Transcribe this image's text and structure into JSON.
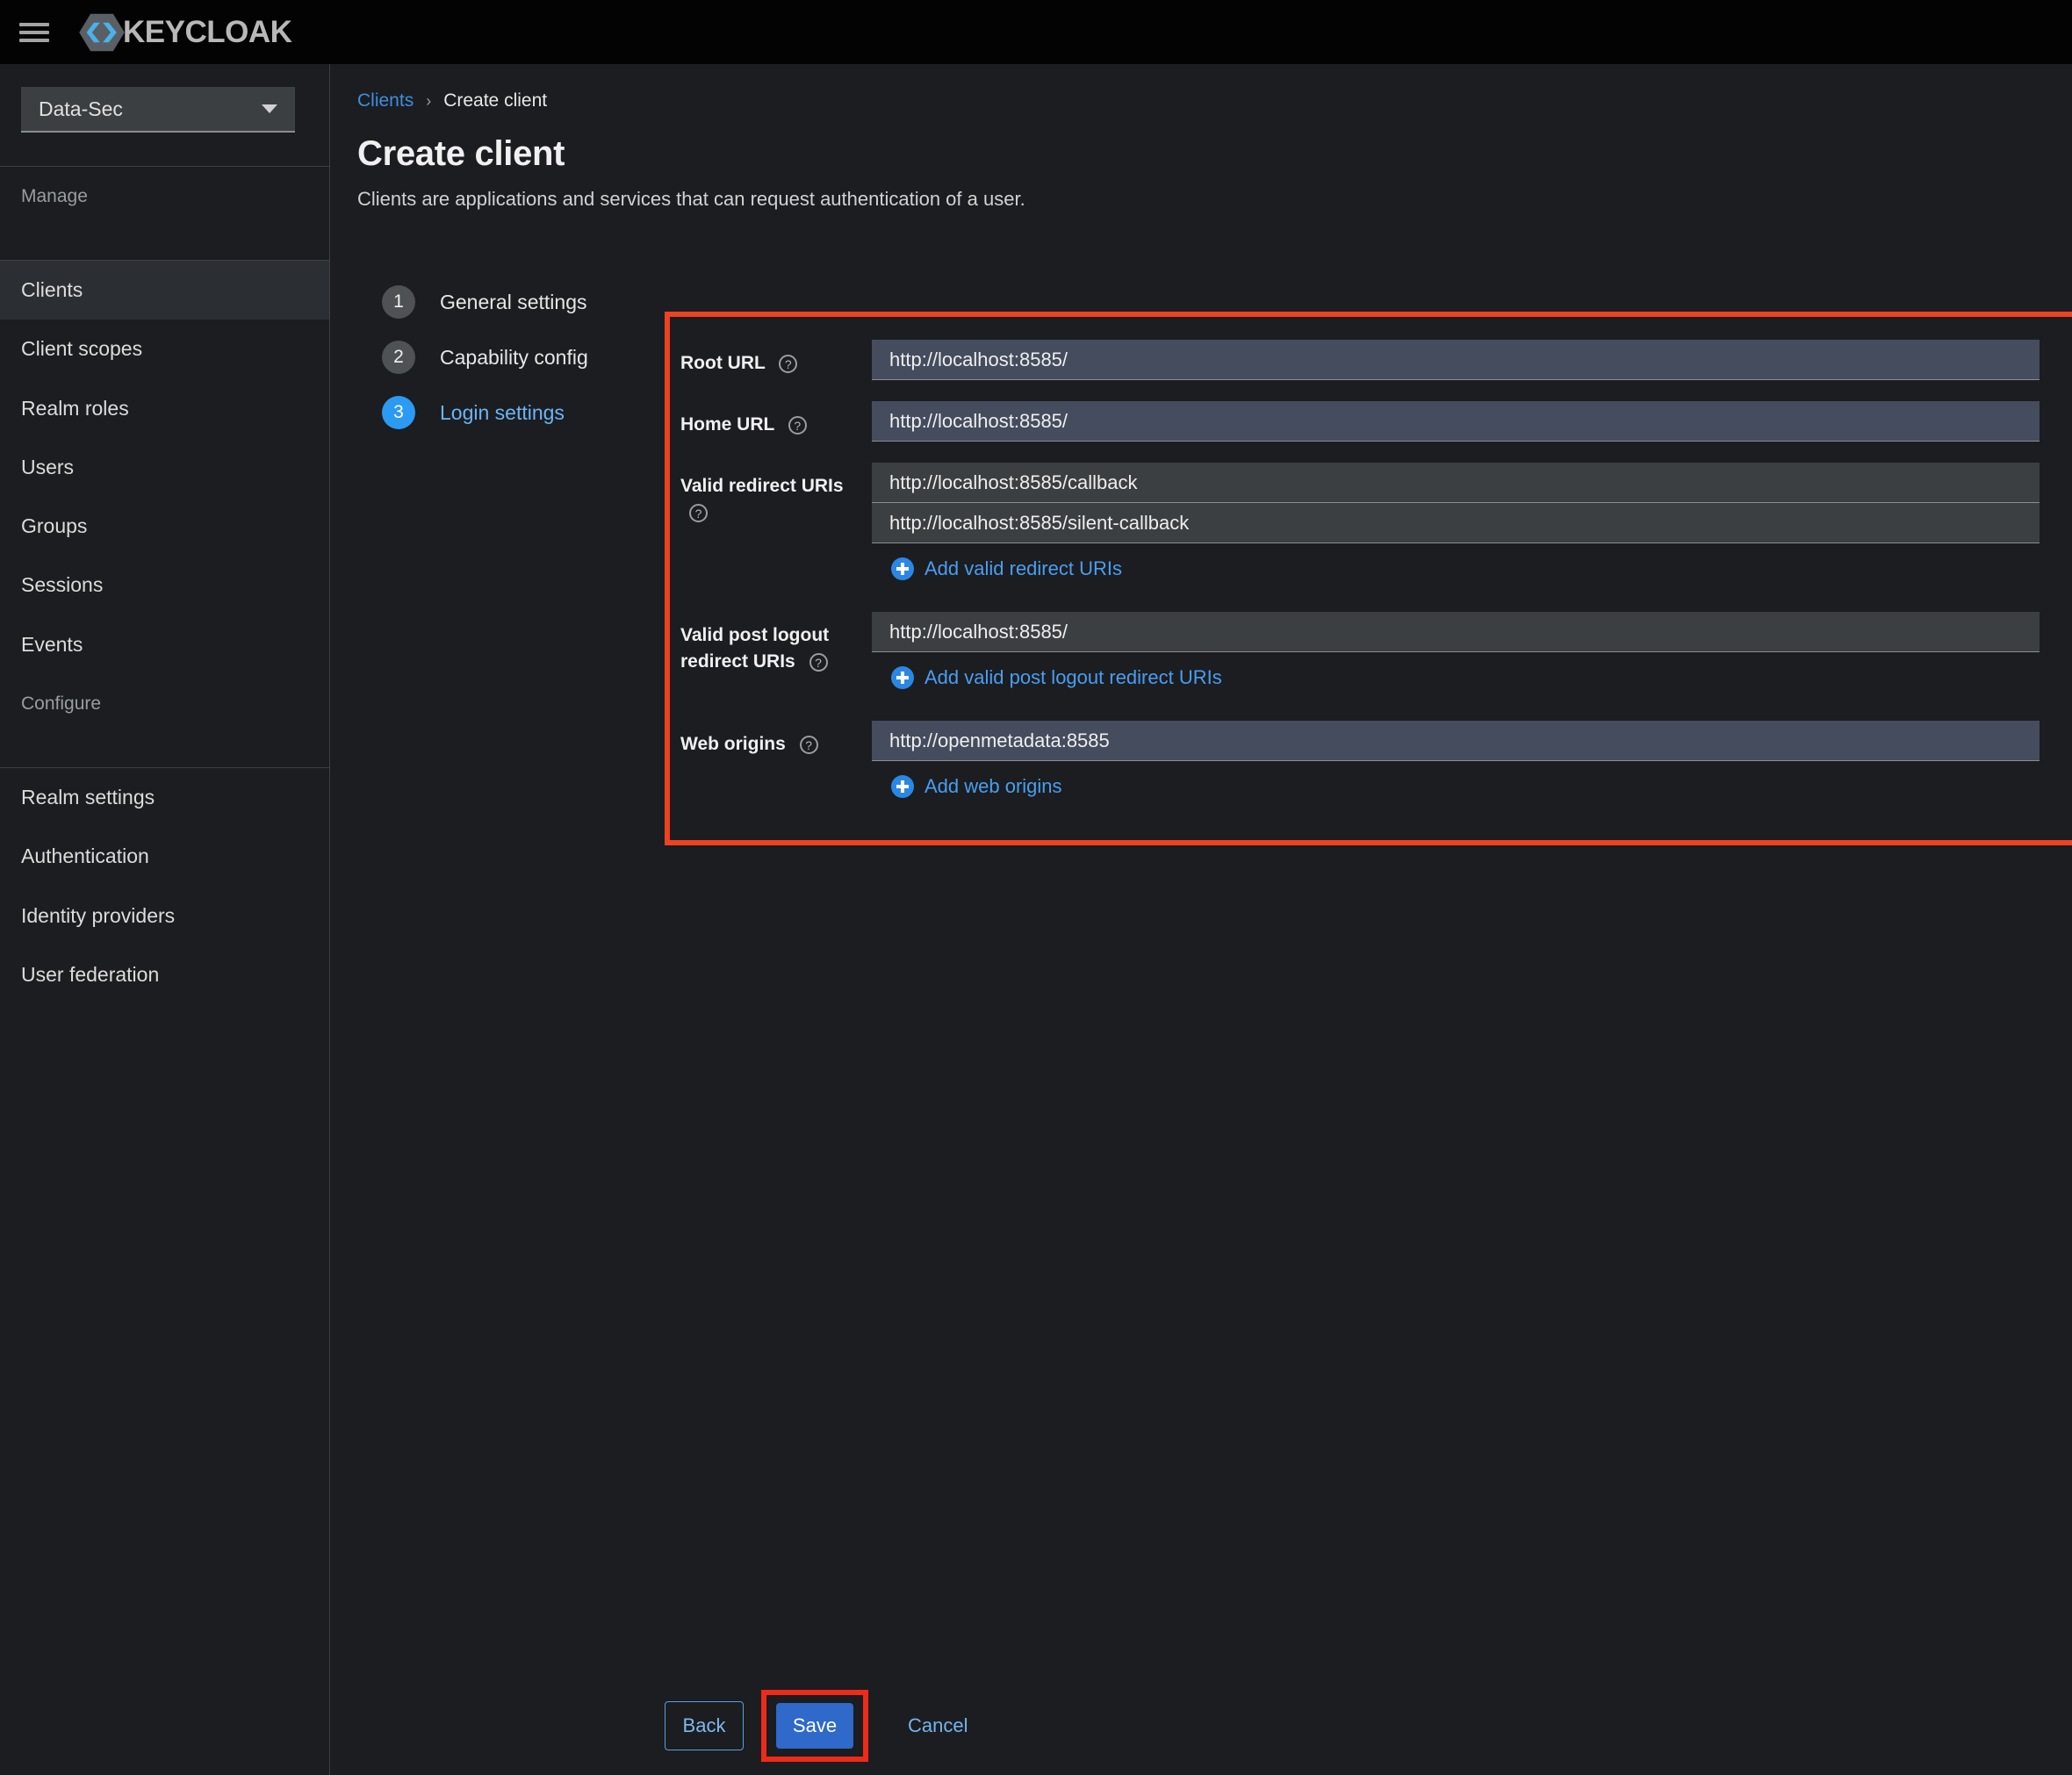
{
  "masthead": {
    "menu_icon": "hamburger-icon",
    "brand_text": "KEYCLOAK",
    "logo_icon": "keycloak-logo-icon"
  },
  "sidebar": {
    "realm": {
      "selected": "Data-Sec",
      "caret_icon": "chevron-down-icon"
    },
    "sections": [
      {
        "title": "Manage",
        "items": [
          {
            "label": "Clients",
            "active": true
          },
          {
            "label": "Client scopes",
            "active": false
          },
          {
            "label": "Realm roles",
            "active": false
          },
          {
            "label": "Users",
            "active": false
          },
          {
            "label": "Groups",
            "active": false
          },
          {
            "label": "Sessions",
            "active": false
          },
          {
            "label": "Events",
            "active": false
          }
        ]
      },
      {
        "title": "Configure",
        "items": [
          {
            "label": "Realm settings",
            "active": false
          },
          {
            "label": "Authentication",
            "active": false
          },
          {
            "label": "Identity providers",
            "active": false
          },
          {
            "label": "User federation",
            "active": false
          }
        ]
      }
    ]
  },
  "breadcrumb": {
    "parent": "Clients",
    "separator": "›",
    "current": "Create client"
  },
  "page": {
    "title": "Create client",
    "subtitle": "Clients are applications and services that can request authentication of a user."
  },
  "wizard": {
    "steps": [
      {
        "num": "1",
        "label": "General settings",
        "active": false
      },
      {
        "num": "2",
        "label": "Capability config",
        "active": false
      },
      {
        "num": "3",
        "label": "Login settings",
        "active": true
      }
    ]
  },
  "form": {
    "help_glyph": "?",
    "root_url": {
      "label": "Root URL",
      "value": "http://localhost:8585/",
      "placeholder": ""
    },
    "home_url": {
      "label": "Home URL",
      "value": "http://localhost:8585/",
      "placeholder": ""
    },
    "valid_redirect_uris": {
      "label": "Valid redirect URIs",
      "values": [
        "http://localhost:8585/callback",
        "http://localhost:8585/silent-callback"
      ],
      "add_label": "Add valid redirect URIs"
    },
    "valid_post_logout_redirect_uris": {
      "label_line1": "Valid post logout",
      "label_line2": "redirect URIs",
      "values": [
        "http://localhost:8585/"
      ],
      "add_label": "Add valid post logout redirect URIs"
    },
    "web_origins": {
      "label": "Web origins",
      "values": [
        "http://openmetadata:8585"
      ],
      "add_label": "Add web origins"
    }
  },
  "actions": {
    "back": "Back",
    "save": "Save",
    "cancel": "Cancel"
  },
  "colors": {
    "accent_blue": "#2b9af3",
    "link_blue": "#4a9ef0",
    "annotation_red": "#ee4222",
    "save_blue": "#2f69c9",
    "page_bg": "#1b1d21",
    "masthead_bg": "#030303",
    "input_bg": "#3c3f42",
    "input_bg_slate": "#454c5e"
  }
}
